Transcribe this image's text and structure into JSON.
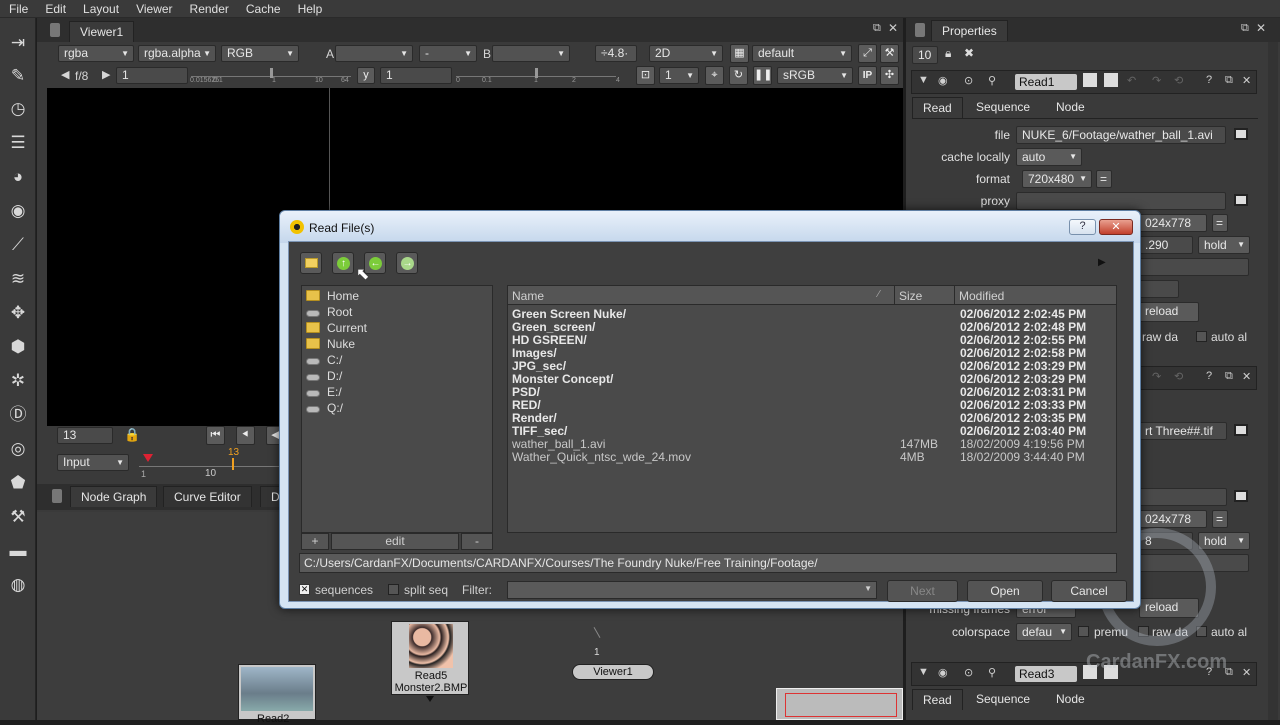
{
  "menubar": [
    "File",
    "Edit",
    "Layout",
    "Viewer",
    "Render",
    "Cache",
    "Help"
  ],
  "viewer": {
    "tab": "Viewer1",
    "channels": "rgba",
    "alpha": "rgba.alpha",
    "rgb": "RGB",
    "a_label": "A",
    "b_label": "B",
    "a_dash": "-",
    "gain_value": "÷4.8·",
    "mode_2d": "2D",
    "lut_default": "default",
    "fstop": "f/8",
    "gain_field": "1",
    "gain_ticks": [
      "0.015625",
      "0.1",
      "1",
      "10",
      "64"
    ],
    "y_label": "y",
    "gamma_field": "1",
    "gamma_ticks": [
      "0",
      "0.1",
      "1",
      "2",
      "4"
    ],
    "frame_field": "1",
    "colorspace": "sRGB",
    "ip": "IP"
  },
  "timeline": {
    "frame": "13",
    "input": "Input",
    "start": "1",
    "marker": "10",
    "current": "13"
  },
  "nodegraph": {
    "tabs": [
      "Node Graph",
      "Curve Editor",
      "D"
    ],
    "read5_label": "Read5",
    "read5_file": "Monster2.BMP",
    "read2_label": "Read2",
    "viewer_node": "Viewer1",
    "viewer_input": "1"
  },
  "properties": {
    "title": "Properties",
    "max_panels": "10",
    "read1": {
      "name": "Read1",
      "tabs": [
        "Read",
        "Sequence",
        "Node"
      ],
      "file_label": "file",
      "file_value": "NUKE_6/Footage/wather_ball_1.avi",
      "cache_label": "cache locally",
      "cache_value": "auto",
      "format_label": "format",
      "format_value": "720x480",
      "format_eq": "=",
      "proxy_label": "proxy",
      "proxy_fmt": "024x778",
      "proxy_eq": "=",
      "range_value": ".290",
      "hold": "hold",
      "reload": "reload",
      "raw": "raw da",
      "auto_alpha": "auto al"
    },
    "read2": {
      "file_value": "rt Three##.tif",
      "proxy_fmt": "024x778",
      "proxy_eq": "=",
      "range_value": "8",
      "hold": "hold",
      "missing_label": "missing frames",
      "missing_value": "error",
      "reload": "reload",
      "colorspace_label": "colorspace",
      "colorspace_value": "defau",
      "premult": "premu",
      "raw": "raw da",
      "auto_alpha": "auto al"
    },
    "read3": {
      "name": "Read3",
      "tabs": [
        "Read",
        "Sequence",
        "Node"
      ]
    }
  },
  "dialog": {
    "title": "Read File(s)",
    "help": "?",
    "close": "✕",
    "places": [
      {
        "name": "Home",
        "kind": "folder"
      },
      {
        "name": "Root",
        "kind": "drive"
      },
      {
        "name": "Current",
        "kind": "folder"
      },
      {
        "name": "Nuke",
        "kind": "folder"
      },
      {
        "name": "C:/",
        "kind": "drive"
      },
      {
        "name": "D:/",
        "kind": "drive"
      },
      {
        "name": "E:/",
        "kind": "drive"
      },
      {
        "name": "Q:/",
        "kind": "drive"
      }
    ],
    "places_add": "+",
    "places_edit": "edit",
    "places_remove": "-",
    "columns": {
      "name": "Name",
      "size": "Size",
      "modified": "Modified"
    },
    "files": [
      {
        "name": "Green Screen Nuke/",
        "size": "",
        "modified": "02/06/2012 2:02:45 PM",
        "dir": true
      },
      {
        "name": "Green_screen/",
        "size": "",
        "modified": "02/06/2012 2:02:48 PM",
        "dir": true
      },
      {
        "name": "HD GSREEN/",
        "size": "",
        "modified": "02/06/2012 2:02:55 PM",
        "dir": true
      },
      {
        "name": "Images/",
        "size": "",
        "modified": "02/06/2012 2:02:58 PM",
        "dir": true
      },
      {
        "name": "JPG_sec/",
        "size": "",
        "modified": "02/06/2012 2:03:29 PM",
        "dir": true
      },
      {
        "name": "Monster Concept/",
        "size": "",
        "modified": "02/06/2012 2:03:29 PM",
        "dir": true
      },
      {
        "name": "PSD/",
        "size": "",
        "modified": "02/06/2012 2:03:31 PM",
        "dir": true
      },
      {
        "name": "RED/",
        "size": "",
        "modified": "02/06/2012 2:03:33 PM",
        "dir": true
      },
      {
        "name": "Render/",
        "size": "",
        "modified": "02/06/2012 2:03:35 PM",
        "dir": true
      },
      {
        "name": "TIFF_sec/",
        "size": "",
        "modified": "02/06/2012 2:03:40 PM",
        "dir": true
      },
      {
        "name": "wather_ball_1.avi",
        "size": "147MB",
        "modified": "18/02/2009 4:19:56 PM",
        "dir": false
      },
      {
        "name": "Wather_Quick_ntsc_wde_24.mov",
        "size": "4MB",
        "modified": "18/02/2009 3:44:40 PM",
        "dir": false
      }
    ],
    "path": "C:/Users/CardanFX/Documents/CARDANFX/Courses/The Foundry Nuke/Free Training/Footage/",
    "sequences_label": "sequences",
    "split_label": "split seq",
    "filter_label": "Filter:",
    "filter_value": "",
    "next": "Next",
    "open": "Open",
    "cancel": "Cancel"
  },
  "watermark": "CardanFX.com",
  "colors": {
    "panel": "#3a3a3a",
    "dialog_frame": "#d5e4f3",
    "node_read": "#c8c8c8",
    "accent_orange": "#f0a020"
  }
}
